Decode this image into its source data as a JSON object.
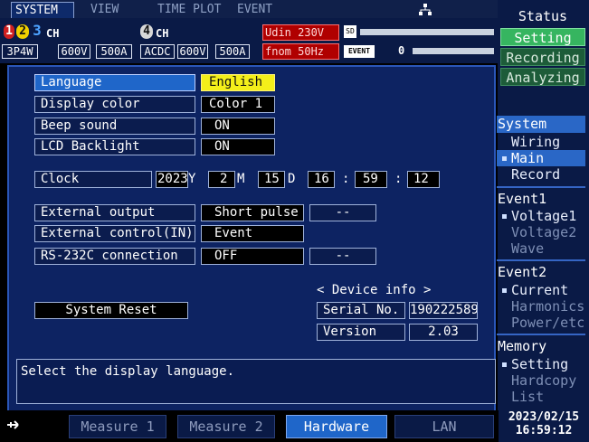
{
  "tabs": {
    "system": "SYSTEM",
    "view": "VIEW",
    "time_plot": "TIME PLOT",
    "event": "EVENT"
  },
  "header": {
    "ch_left_label": "CH",
    "ch_right_label": "CH",
    "ch_left_digits": [
      "1",
      "2",
      "3"
    ],
    "ch_right_digit": "4",
    "wiring": "3P4W",
    "v_range_left": "600V",
    "a_range_left": "500A",
    "coupling": "ACDC",
    "v_range_right": "600V",
    "a_range_right": "500A",
    "udin": "Udin 230V",
    "fnom": "fnom  50Hz",
    "sd_label": "SD",
    "event_badge": "EVENT",
    "event_count": "0"
  },
  "settings": [
    {
      "label": "Language",
      "value": "English"
    },
    {
      "label": "Display color",
      "value": "Color 1"
    },
    {
      "label": "Beep sound",
      "value": "ON"
    },
    {
      "label": "LCD Backlight",
      "value": "ON"
    }
  ],
  "clock": {
    "label": "Clock",
    "year": "2023",
    "year_unit": "Y",
    "month": "2",
    "month_unit": "M",
    "day": "15",
    "day_unit": "D",
    "hour": "16",
    "sep1": ":",
    "minute": "59",
    "sep2": ":",
    "second": "12"
  },
  "io": [
    {
      "label": "External output",
      "value": "Short pulse",
      "extra": "--"
    },
    {
      "label": "External control(IN)",
      "value": "Event"
    },
    {
      "label": "RS-232C connection",
      "value": "OFF",
      "extra": "--"
    }
  ],
  "system_reset": "System Reset",
  "device_info": {
    "title": "< Device info >",
    "serial_label": "Serial No.",
    "serial_value": "190222589",
    "version_label": "Version",
    "version_value": "2.03"
  },
  "message": "Select the display language.",
  "side": {
    "status": "Status",
    "setting": "Setting",
    "recording": "Recording",
    "analyzing": "Analyzing",
    "system_head": "System",
    "system_items": [
      "Wiring",
      "Main",
      "Record"
    ],
    "event1": "Event1",
    "event1_items": [
      "Voltage1",
      "Voltage2",
      "Wave"
    ],
    "event2": "Event2",
    "event2_items": [
      "Current",
      "Harmonics",
      "Power/etc"
    ],
    "memory": "Memory",
    "memory_items": [
      "Setting",
      "Hardcopy",
      "List"
    ]
  },
  "bottom_tabs": [
    "Measure 1",
    "Measure 2",
    "Hardware",
    "LAN"
  ],
  "datetime": {
    "date": "2023/02/15",
    "time": "16:59:12"
  },
  "colors": {
    "highlight": "#f4ef1a",
    "selected": "#1f66c9",
    "panel": "#0d2362",
    "active_status": "#36b560"
  }
}
